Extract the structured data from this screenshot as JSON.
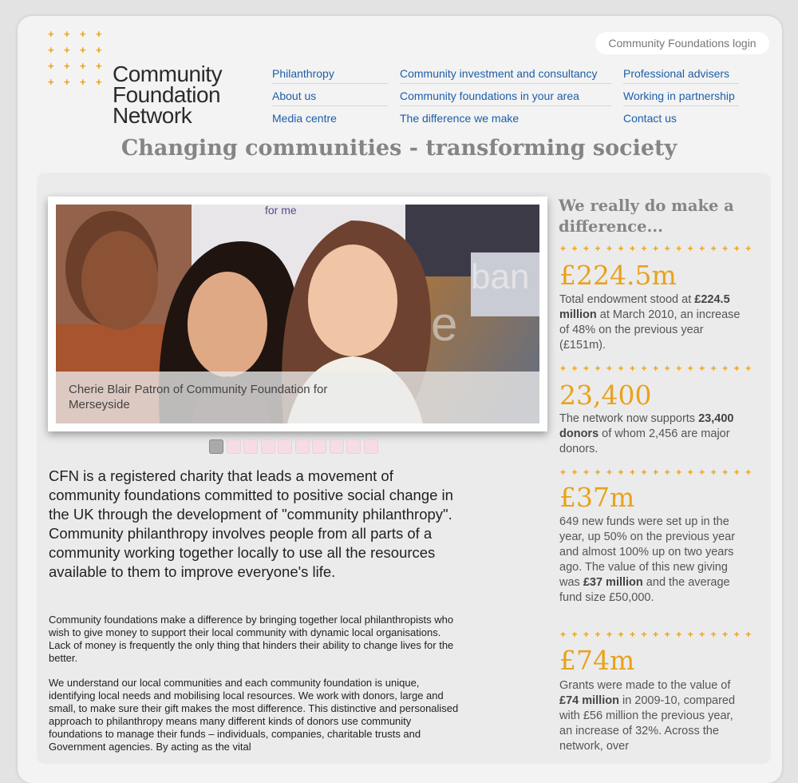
{
  "header": {
    "login_label": "Community Foundations login",
    "logo_lines": [
      "Community",
      "Foundation",
      "Network"
    ]
  },
  "nav": {
    "col1": [
      "Philanthropy",
      "About us",
      "Media centre"
    ],
    "col2": [
      "Community investment and consultancy",
      "Community foundations in your area",
      "The difference we make"
    ],
    "col3": [
      "Professional advisers",
      "Working in partnership",
      "Contact us"
    ]
  },
  "tagline": "Changing communities - transforming society",
  "slideshow": {
    "caption": "Cherie Blair Patron of Community Foundation for Merseyside",
    "slide_count": 10,
    "active_slide": 1
  },
  "main": {
    "intro": "CFN is a registered charity that leads a movement of community foundations committed to positive social change in the UK through the development of \"community philanthropy\".  Community philanthropy involves people from all parts of a community working together locally to use all the resources available to them to improve everyone's life.",
    "para1": "Community foundations make a difference by bringing together local philanthropists who wish to give money to support their local community with dynamic local organisations. Lack of money is frequently the only thing that hinders their ability to change lives for the better.",
    "para2": "We understand our local communities and each community foundation is unique, identifying local needs and mobilising local resources. We work with donors, large and small, to make sure their gift makes the most difference. This distinctive and personalised approach to philanthropy means many different kinds of donors use community foundations to manage their funds – individuals, companies, charitable trusts and Government agencies. By acting as the vital"
  },
  "sidebar": {
    "heading": "We really do make a difference...",
    "stats": [
      {
        "figure": "£224.5m",
        "pre": "Total endowment stood at ",
        "bold1": "£224.5 million",
        "post": " at March 2010, an increase of 48% on the previous year (£151m).",
        "bold2": "",
        "tail": ""
      },
      {
        "figure": "23,400",
        "pre": "The network now supports ",
        "bold1": "23,400 donors",
        "post": " of whom 2,456 are major donors.",
        "bold2": "",
        "tail": ""
      },
      {
        "figure": "£37m",
        "pre": "649 new funds were set up in the year, up 50% on the previous year and almost 100% up on two years ago. The value of this new giving was ",
        "bold1": "£37 million",
        "post": " and the average fund size £50,000.",
        "bold2": "",
        "tail": ""
      },
      {
        "figure": "£74m",
        "pre": "Grants were made to the value of ",
        "bold1": "£74 million",
        "post": " in 2009-10, compared with £56 million the previous year, an increase of 32%. Across the network, over",
        "bold2": "",
        "tail": ""
      }
    ]
  },
  "colors": {
    "accent": "#e8a21c",
    "link": "#1d5ea8",
    "heading_grey": "#858585"
  }
}
